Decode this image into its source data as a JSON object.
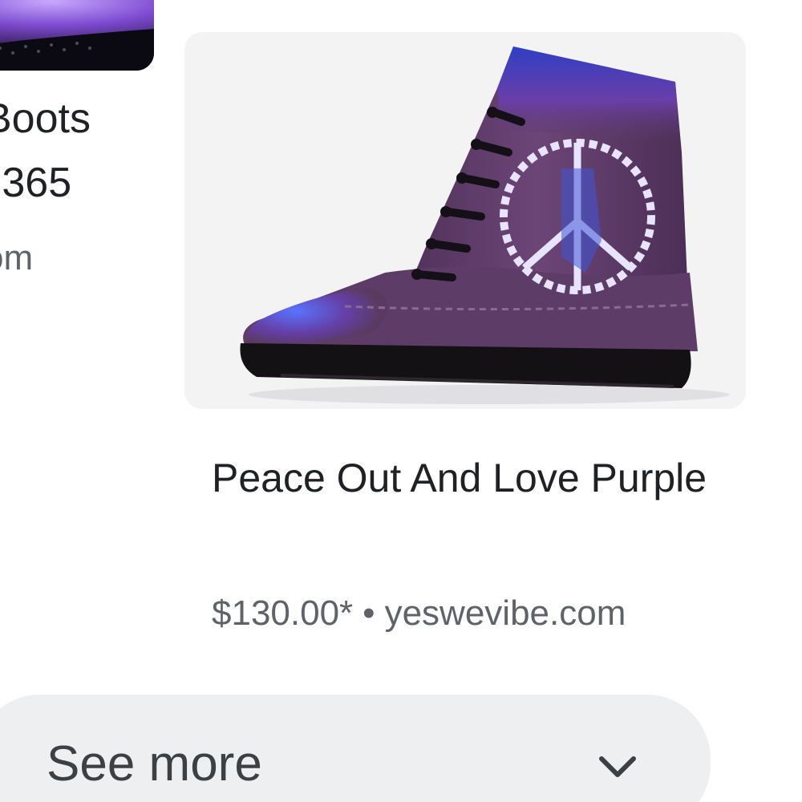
{
  "left_card": {
    "title_fragment": "Boots",
    "price_fragment": "' 365",
    "source_fragment": "om"
  },
  "main_card": {
    "image_alt": "Purple peace-sign lace-up combat boot",
    "title": "Peace Out And Love Purple",
    "price": "$130.00*",
    "separator": "•",
    "source": "yeswevibe.com"
  },
  "see_more": {
    "label": "See more",
    "icon": "chevron-down-icon"
  },
  "colors": {
    "text_primary": "#202124",
    "text_secondary": "#5f6368",
    "image_bg": "#f3f3f4",
    "see_more_bg": "#eeeff1",
    "boot_purple": "#5b3a62",
    "pattern_blue": "#3d4fd8"
  }
}
